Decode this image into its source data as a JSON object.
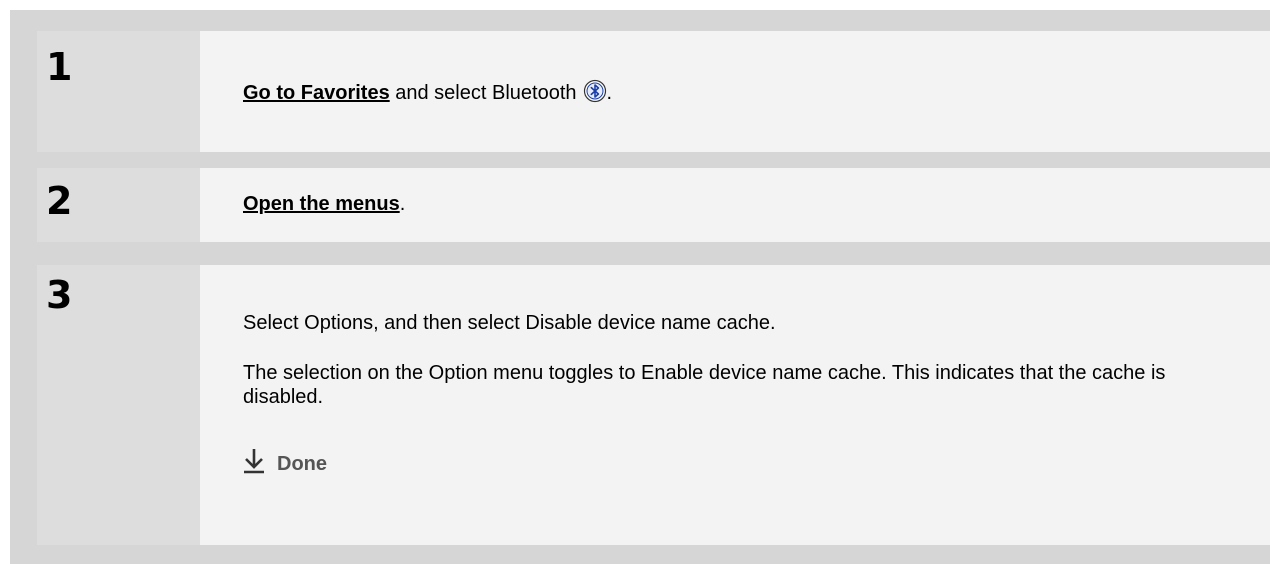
{
  "steps": [
    {
      "number": "1",
      "link": "Go to Favorites",
      "text": " and select Bluetooth",
      "icon": "bluetooth-icon",
      "end": "."
    },
    {
      "number": "2",
      "link": "Open the menus",
      "end": "."
    },
    {
      "number": "3",
      "para1": "Select Options, and then select Disable device name cache.",
      "para2": "The selection on the Option menu toggles to Enable device name cache. This indicates that the cache is disabled.",
      "done_label": "Done",
      "done_icon": "down-arrow-icon"
    }
  ],
  "colors": {
    "frame": "#d6d6d6",
    "step_background": "#f3f3f3",
    "number_cell": "#dddddd",
    "done_text": "#555555",
    "bluetooth": "#1a3fa8"
  }
}
